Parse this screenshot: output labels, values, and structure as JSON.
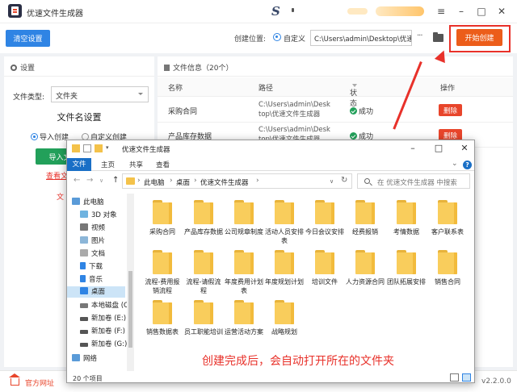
{
  "app": {
    "title": "优速文件生成器",
    "version": "v2.2.0.0"
  },
  "toolbar": {
    "clear_label": "清空设置",
    "location_label": "创建位置:",
    "location_option": "自定义",
    "path_value": "C:\\Users\\admin\\Desktop\\优速",
    "more_label": "···",
    "start_label": "开始创建"
  },
  "settings": {
    "header": "设置",
    "file_type_label": "文件类型:",
    "file_type_value": "文件夹",
    "section_title": "文件名设置",
    "option_import": "导入创建",
    "option_custom": "自定义创建",
    "import_button": "导入文",
    "view_link": "查看文",
    "partial_text": "文"
  },
  "fileinfo": {
    "header": "文件信息（20个）",
    "columns": {
      "name": "名称",
      "path": "路径",
      "status": "状态",
      "action": "操作"
    },
    "rows": [
      {
        "name": "采购合同",
        "path": "C:\\Users\\admin\\Desktop\\优速文件生成器",
        "status": "成功",
        "action": "删除"
      },
      {
        "name": "产品库存数据",
        "path": "C:\\Users\\admin\\Desktop\\优速文件生成器",
        "status": "成功",
        "action": "删除"
      }
    ]
  },
  "explorer": {
    "title": "优速文件生成器",
    "ribbon": {
      "file": "文件",
      "home": "主页",
      "share": "共享",
      "view": "查看"
    },
    "breadcrumb": [
      "此电脑",
      "桌面",
      "优速文件生成器"
    ],
    "search_placeholder": "在 优速文件生成器 中搜索",
    "nav": [
      "此电脑",
      "3D 对象",
      "视频",
      "图片",
      "文档",
      "下载",
      "音乐",
      "桌面",
      "本地磁盘 (C",
      "新加卷 (E:)",
      "新加卷 (F:)",
      "新加卷 (G:)",
      "网络"
    ],
    "folders": [
      "采购合同",
      "产品库存数据",
      "公司规章制度",
      "活动人员安排表",
      "今日会议安排",
      "经费报销",
      "考情数据",
      "客户联系表",
      "流程-费用报销流程",
      "流程-请假流程",
      "年度费用计划表",
      "年度规划计划",
      "培训文件",
      "人力资源合同",
      "团队拓展安排",
      "销售合同",
      "销售数据表",
      "员工职能培训",
      "运营活动方案",
      "战略规划"
    ],
    "status_count": "20 个项目"
  },
  "footer": {
    "home_label": "官方网址"
  },
  "caption": "创建完成后，会自动打开所在的文件夹",
  "colors": {
    "accent_blue": "#2f84e4",
    "start_orange": "#ec5d1a",
    "delete_red": "#e8452b",
    "success_green": "#22a05a"
  }
}
